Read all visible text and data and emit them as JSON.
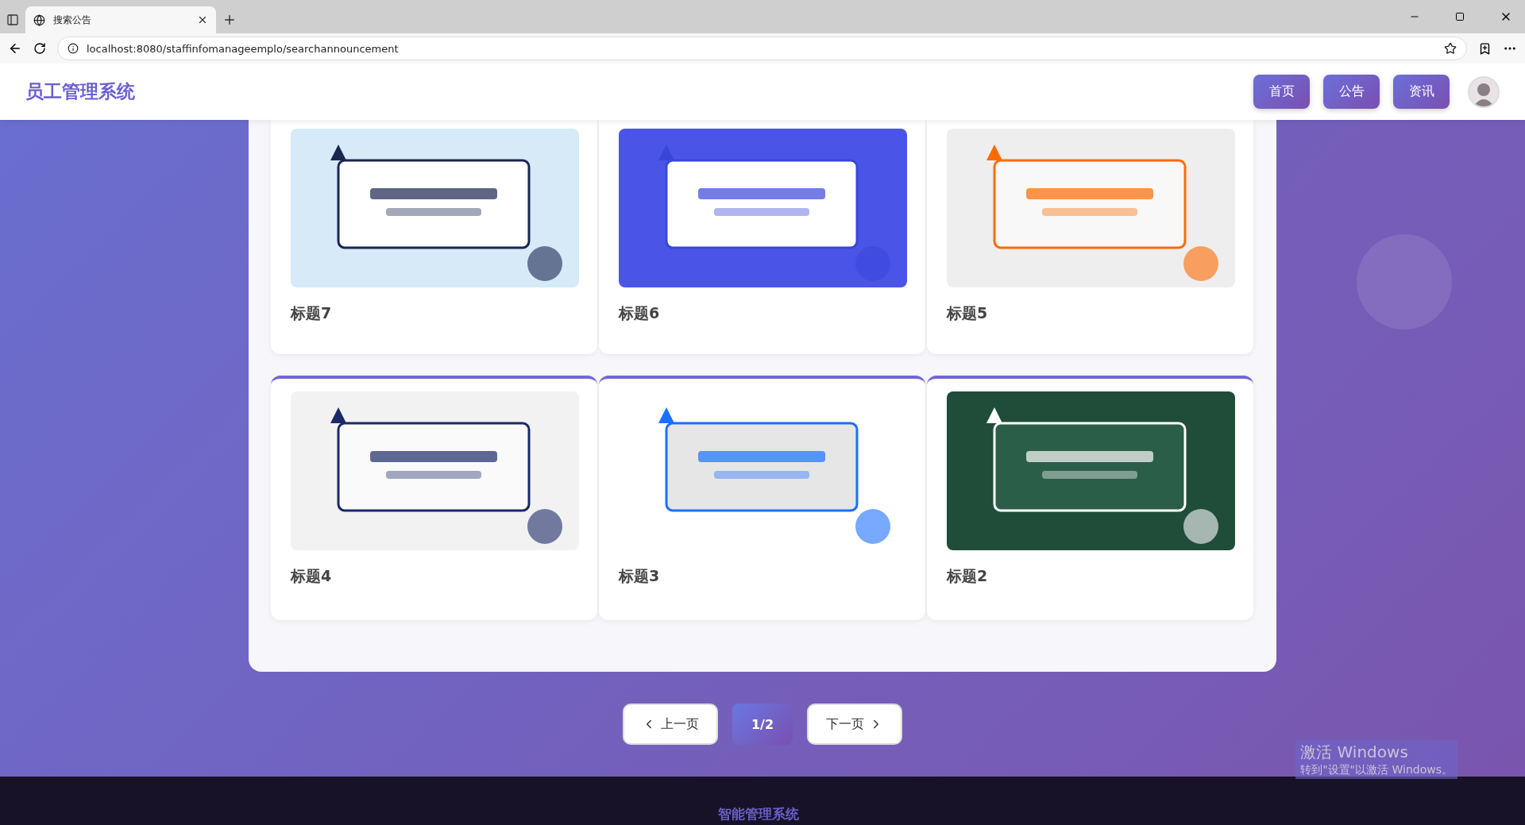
{
  "browser": {
    "tab_title": "搜索公告",
    "url": "localhost:8080/staffinfomanageemplo/searchannouncement"
  },
  "header": {
    "logo": "员工管理系统",
    "nav": [
      {
        "label": "首页",
        "selected": false
      },
      {
        "label": "公告",
        "selected": false
      },
      {
        "label": "资讯",
        "selected": false
      }
    ]
  },
  "cards": [
    {
      "title": "标题7"
    },
    {
      "title": "标题6"
    },
    {
      "title": "标题5"
    },
    {
      "title": "标题4"
    },
    {
      "title": "标题3"
    },
    {
      "title": "标题2"
    }
  ],
  "pagination": {
    "prev": "上一页",
    "page": "1/2",
    "next": "下一页"
  },
  "footer": {
    "text": "智能管理系统"
  },
  "os_watermark": {
    "title": "激活 Windows",
    "subtitle": "转到\"设置\"以激活 Windows。"
  }
}
